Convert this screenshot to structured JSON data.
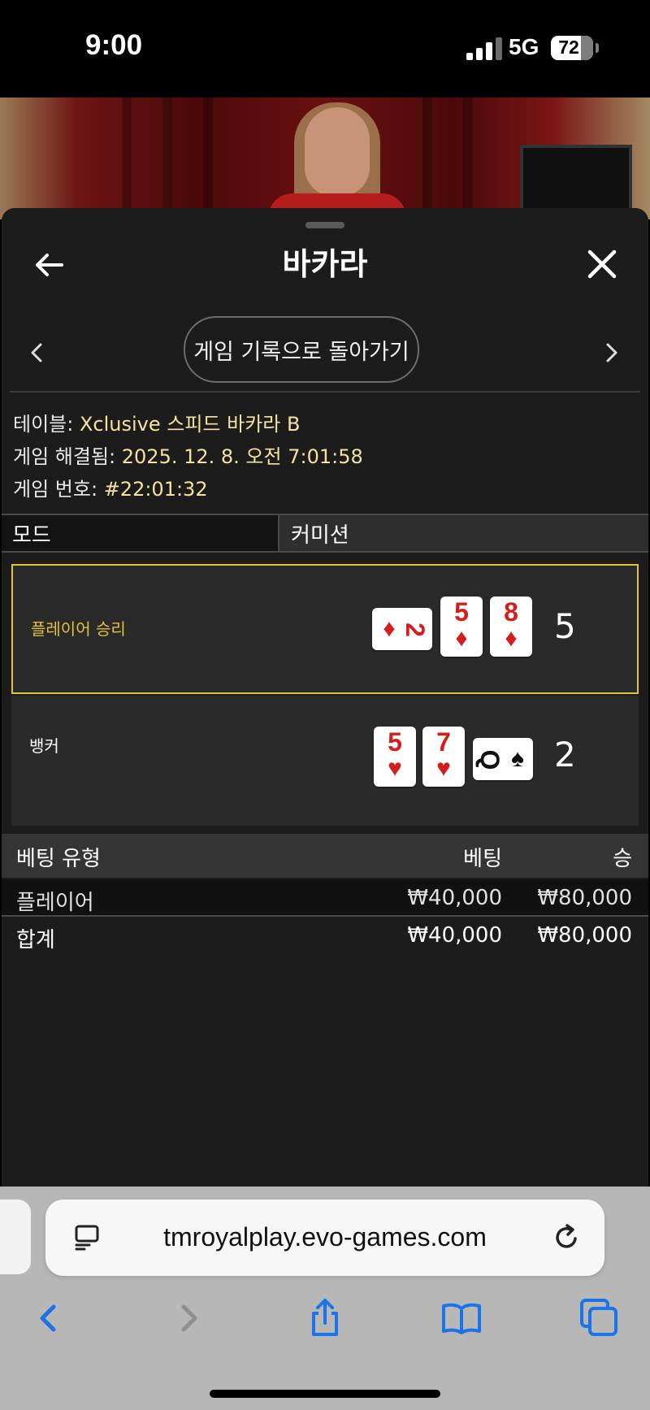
{
  "status_bar": {
    "time": "9:00",
    "network": "5G",
    "battery_level": "72"
  },
  "header": {
    "title": "바카라"
  },
  "nav": {
    "history_button": "게임 기록으로 돌아가기"
  },
  "info": {
    "table_label": "테이블:",
    "table_value": "Xclusive 스피드 바카라 B",
    "resolved_label": "게임 해결됨:",
    "resolved_value": "2025. 12. 8. 오전 7:01:58",
    "number_label": "게임 번호:",
    "number_value": "#22:01:32"
  },
  "mode": {
    "left": "모드",
    "right": "커미션"
  },
  "results": {
    "player": {
      "label": "플레이어 승리",
      "score": "5",
      "label_color": "#e1c23a",
      "cards": [
        {
          "rank": "2",
          "suit": "♦"
        },
        {
          "rank": "5",
          "suit": "♦"
        },
        {
          "rank": "8",
          "suit": "♦"
        }
      ]
    },
    "banker": {
      "label": "뱅커",
      "score": "2",
      "cards": [
        {
          "rank": "5",
          "suit": "♥"
        },
        {
          "rank": "7",
          "suit": "♥"
        },
        {
          "rank": "Q",
          "suit": "♠"
        }
      ]
    }
  },
  "bets": {
    "headers": {
      "type": "베팅 유형",
      "bet": "베팅",
      "win": "승"
    },
    "rows": [
      {
        "type": "플레이어",
        "bet": "₩40,000",
        "win": "₩80,000"
      }
    ],
    "total": {
      "type": "합계",
      "bet": "₩40,000",
      "win": "₩80,000"
    }
  },
  "browser": {
    "url": "tmroyalplay.evo-games.com",
    "accent": "#1a73e8"
  }
}
